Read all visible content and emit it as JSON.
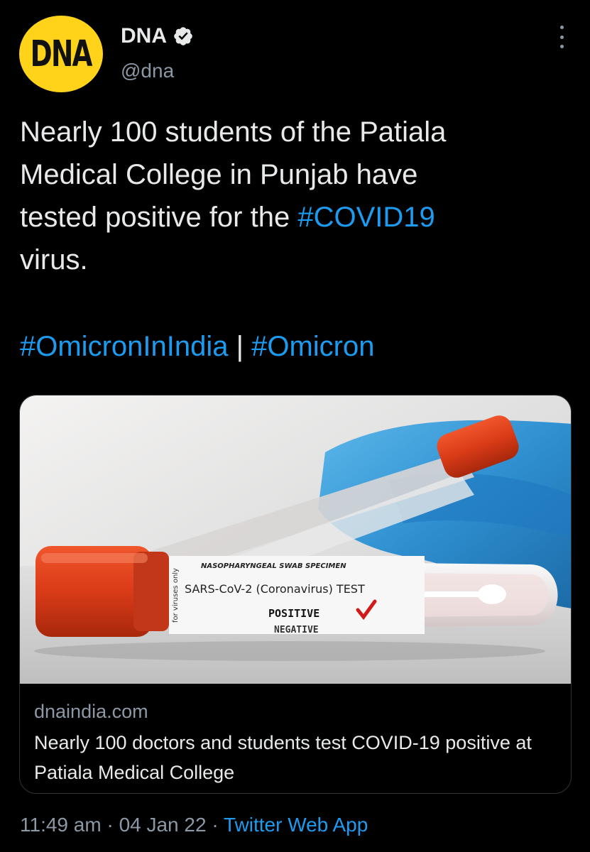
{
  "author": {
    "avatar_text": "DNA",
    "name": "DNA",
    "handle": "@dna",
    "verified": true
  },
  "icons": {
    "verified": "verified-badge-icon",
    "more": "more-options-icon"
  },
  "tweet": {
    "line1": "Nearly 100 students of the Patiala",
    "line2": "Medical College in Punjab have",
    "line3_prefix": "tested positive for the ",
    "line3_hashtag": "#COVID19",
    "line4": "virus.",
    "hashtag1": "#OmicronInIndia",
    "separator": " | ",
    "hashtag2": "#Omicron"
  },
  "card": {
    "label_line1": "NASOPHARYNGEAL SWAB SPECIMEN",
    "label_line2": "SARS-CoV-2 (Coronavirus) TEST",
    "label_line3": "POSITIVE",
    "label_line4": "NEGATIVE",
    "label_side": "for viruses only",
    "domain": "dnaindia.com",
    "title": "Nearly 100 doctors and students test COVID-19 positive at Patiala Medical College"
  },
  "meta": {
    "time": "11:49 am",
    "dot1": " · ",
    "date": "04 Jan 22",
    "dot2": " · ",
    "source": "Twitter Web App"
  },
  "colors": {
    "background": "#000000",
    "text": "#e7e9ea",
    "secondary": "#8b98a5",
    "link": "#1d9bf0",
    "avatar_bg": "#ffd31a"
  }
}
